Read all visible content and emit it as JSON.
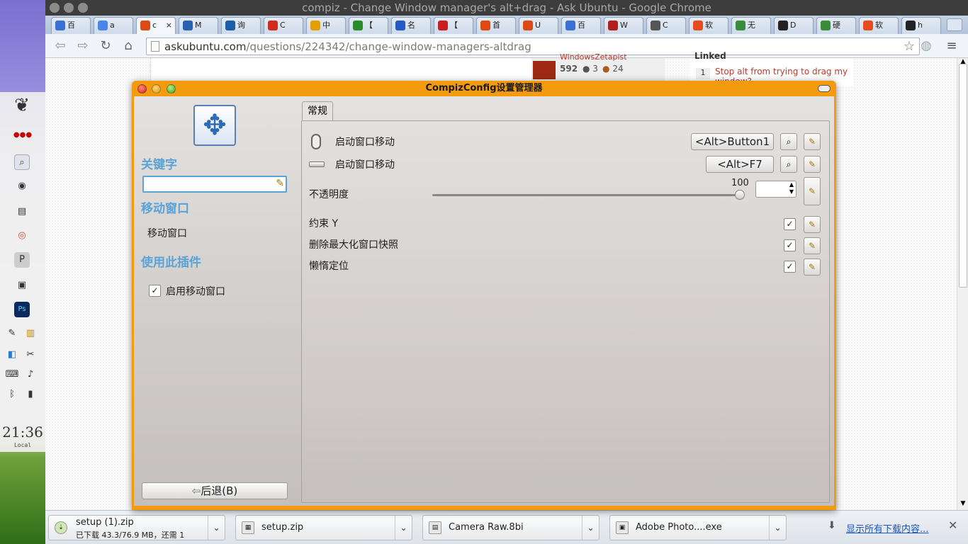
{
  "browser": {
    "window_title": "compiz - Change Window manager's alt+drag - Ask Ubuntu - Google Chrome",
    "tabs": [
      {
        "label": "百",
        "icon": "baidu-icon",
        "color": "#3a6fd8"
      },
      {
        "label": "a",
        "icon": "google-icon",
        "color": "#4a86e8"
      },
      {
        "label": "c",
        "icon": "askubuntu-icon",
        "color": "#dd4814"
      },
      {
        "label": "M",
        "icon": "moon-icon",
        "color": "#2b5fb0"
      },
      {
        "label": "询",
        "icon": "dict-icon",
        "color": "#1b5ea8"
      },
      {
        "label": "C",
        "icon": "ps-icon",
        "color": "#d12b1f"
      },
      {
        "label": "中",
        "icon": "trophy-icon",
        "color": "#e2a000"
      },
      {
        "label": "【",
        "icon": "flag-icon",
        "color": "#2a8b2a"
      },
      {
        "label": "名",
        "icon": "paw-icon",
        "color": "#2559c7"
      },
      {
        "label": "【",
        "icon": "puzzle-icon",
        "color": "#c81e1e"
      },
      {
        "label": "首",
        "icon": "ubuntu-icon",
        "color": "#dd4814"
      },
      {
        "label": "U",
        "icon": "ubuntu-icon",
        "color": "#dd4814"
      },
      {
        "label": "百",
        "icon": "link-icon",
        "color": "#3a6fd8"
      },
      {
        "label": "W",
        "icon": "w-icon",
        "color": "#b02020"
      },
      {
        "label": "C",
        "icon": "wikipedia-icon",
        "color": "#555555"
      },
      {
        "label": "软",
        "icon": "app-icon",
        "color": "#e84c1c"
      },
      {
        "label": "无",
        "icon": "chrome-icon",
        "color": "#3a8b3a"
      },
      {
        "label": "D",
        "icon": "p-icon",
        "color": "#222222"
      },
      {
        "label": "硬",
        "icon": "chrome-icon",
        "color": "#3a8b3a"
      },
      {
        "label": "软",
        "icon": "app-icon",
        "color": "#e84c1c"
      },
      {
        "label": "h",
        "icon": "p-icon",
        "color": "#222222"
      }
    ],
    "close_tab_glyph": "×",
    "url_domain": "askubuntu.com",
    "url_path": "/questions/224342/change-window-managers-altdrag"
  },
  "page": {
    "user_link": "WindowsZetapist",
    "user_rep": "592",
    "user_silver": "3",
    "user_bronze": "24",
    "sidebar_heading": "Linked",
    "linked_score": "1",
    "linked_title": "Stop alt from trying to drag my window?"
  },
  "ccsm": {
    "title": "CompizConfig设置管理器",
    "sidebar": {
      "search_heading": "关键字",
      "search_value": "",
      "plugin_heading": "移动窗口",
      "plugin_name": "移动窗口",
      "use_heading": "使用此插件",
      "enable_label": "启用移动窗口",
      "back_label": "后退(B)"
    },
    "tab_label": "常规",
    "settings": {
      "move_mouse_label": "启动窗口移动",
      "move_mouse_value": "<Alt>Button1",
      "move_key_label": "启动窗口移动",
      "move_key_value": "<Alt>F7",
      "opacity_label": "不透明度",
      "opacity_value": "100",
      "opacity_max": "100",
      "constrain_label": "约束 Y",
      "snapoff_label": "删除最大化窗口快照",
      "lazy_label": "懒惰定位"
    }
  },
  "downloads": [
    {
      "name": "setup (1).zip",
      "status": "已下载 43.3/76.9 MB，还需 1"
    },
    {
      "name": "setup.zip"
    },
    {
      "name": "Camera Raw.8bi"
    },
    {
      "name": "Adobe Photo....exe"
    }
  ],
  "shelf_link": "显示所有下载内容...",
  "desktop": {
    "clock": "21:36",
    "clock_label": "Local"
  }
}
